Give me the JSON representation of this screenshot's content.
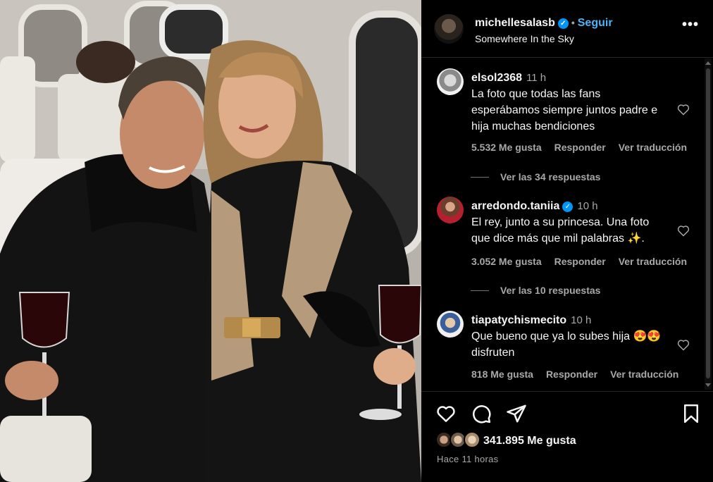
{
  "header": {
    "username": "michellesalasb",
    "verified_glyph": "✓",
    "separator": "•",
    "follow_label": "Seguir",
    "location": "Somewhere In the Sky",
    "more_icon": "more-horizontal-icon",
    "more_glyph": "•••"
  },
  "comments": [
    {
      "username": "elsol2368",
      "time": "11 h",
      "text": "La foto que todas las fans esperábamos siempre juntos padre e hija muchas bendiciones",
      "likes": "5.532 Me gusta",
      "reply_label": "Responder",
      "translate_label": "Ver traducción",
      "view_replies": "Ver las 34 respuestas"
    },
    {
      "username": "arredondo.taniia",
      "verified": true,
      "time": "10 h",
      "text": "El rey, junto a su princesa. Una foto que dice más que mil palabras ✨.",
      "likes": "3.052 Me gusta",
      "reply_label": "Responder",
      "translate_label": "Ver traducción",
      "view_replies": "Ver las 10 respuestas"
    },
    {
      "username": "tiapatychismecito",
      "time": "10 h",
      "text": "Que bueno que ya lo subes hija 😍😍 disfruten",
      "likes": "818 Me gusta",
      "reply_label": "Responder",
      "translate_label": "Ver traducción"
    }
  ],
  "actions": {
    "icons": [
      "heart-icon",
      "comment-icon",
      "share-icon",
      "bookmark-icon"
    ],
    "likes": "341.895 Me gusta",
    "time_ago": "Hace 11 horas"
  },
  "colors": {
    "background": "#000000",
    "text": "#f5f5f5",
    "muted": "#a8a8a8",
    "accent": "#4cb5f9",
    "verified": "#0095f6",
    "divider": "#262626"
  }
}
